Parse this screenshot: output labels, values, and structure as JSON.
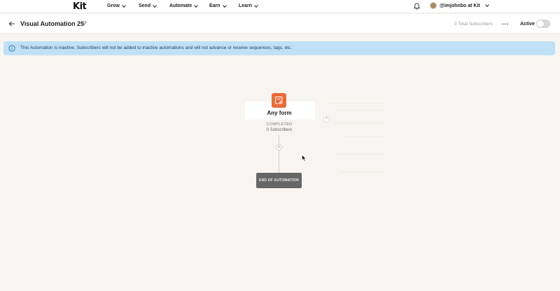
{
  "nav": {
    "logo": "Kit",
    "items": [
      {
        "label": "Grow"
      },
      {
        "label": "Send"
      },
      {
        "label": "Automate"
      },
      {
        "label": "Earn"
      },
      {
        "label": "Learn"
      }
    ],
    "user_label": "@imjohnbo at Kit"
  },
  "header": {
    "title": "Visual Automation 25",
    "total_subscribers": "0 Total Subscribers",
    "more_label": "•••",
    "active_label": "Active",
    "active_on": false
  },
  "banner": {
    "text": "This Automation is inactive. Subscribers will not be added to inactive automations and will not advance or receive sequences, tags, etc.",
    "color": "#bfe0f7"
  },
  "flow": {
    "trigger": {
      "label": "Any form",
      "status": "COMPLETED",
      "subscribers": "0 Subscribers",
      "icon": "form-icon",
      "color": "#e86a3a"
    },
    "add_step": "+",
    "branch_step": "+",
    "end_label": "END OF AUTOMATION"
  }
}
